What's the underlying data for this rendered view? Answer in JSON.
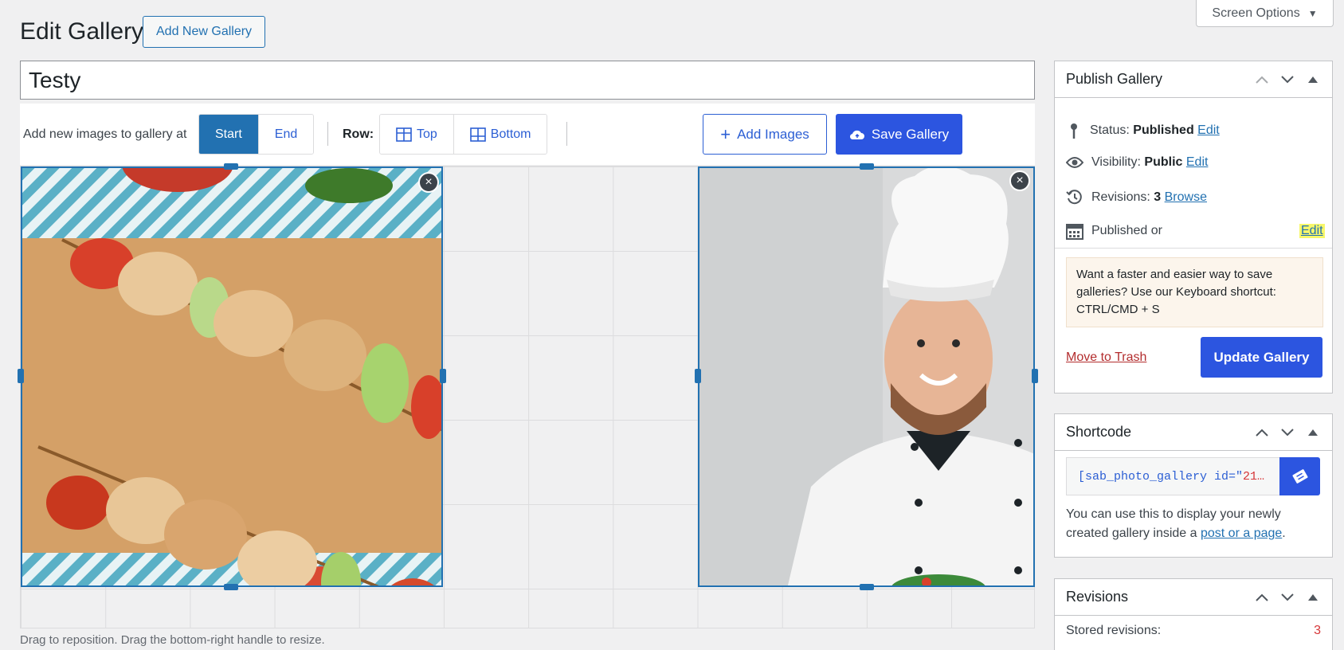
{
  "header": {
    "title": "Edit Gallery",
    "add_new_label": "Add New Gallery",
    "screen_options_label": "Screen Options"
  },
  "gallery_title": "Testy",
  "toolbar": {
    "add_at_label": "Add new images to gallery at",
    "start_label": "Start",
    "end_label": "End",
    "row_label": "Row:",
    "top_label": "Top",
    "bottom_label": "Bottom",
    "add_images_label": "Add Images",
    "save_label": "Save Gallery",
    "active_position": "Start"
  },
  "grid": {
    "hint": "Drag to reposition. Drag the bottom-right handle to resize.",
    "tiles": [
      {
        "name": "skewers-image",
        "description_icon": "photo"
      },
      {
        "name": "chef-image",
        "description_icon": "photo"
      }
    ],
    "remove_symbol": "×"
  },
  "publish": {
    "title": "Publish Gallery",
    "status_label": "Status:",
    "status_value": "Published",
    "status_edit": "Edit",
    "visibility_label": "Visibility:",
    "visibility_value": "Public",
    "visibility_edit": "Edit",
    "revisions_label": "Revisions:",
    "revisions_value": "3",
    "revisions_browse": "Browse",
    "published_on_label": "Published or",
    "published_on_edit": "Edit",
    "notice_line1": "Want a faster and easier way to save galleries? Use our Keyboard shortcut:",
    "notice_shortcut": "CTRL/CMD + S",
    "trash_label": "Move to Trash",
    "update_label": "Update Gallery"
  },
  "shortcode": {
    "title": "Shortcode",
    "code_prefix": "[sab_photo_gallery id=\"",
    "code_suffix": "21…",
    "desc_prefix": "You can use this to display your newly created gallery inside a ",
    "desc_link": "post or a page",
    "desc_suffix": "."
  },
  "revisions": {
    "title": "Revisions",
    "stored_label": "Stored revisions:",
    "stored_count": "3"
  },
  "colors": {
    "accent": "#2c55e0",
    "wp_blue": "#2271b1",
    "danger": "#b32d2e",
    "highlight": "#f7f76a"
  },
  "icons": [
    "pin-icon",
    "eye-icon",
    "history-icon",
    "calendar-icon",
    "plus-icon",
    "cloud-upload-icon",
    "copy-icon",
    "chevron-up-icon",
    "chevron-down-icon",
    "triangle-up-icon",
    "close-icon",
    "table-top-icon",
    "table-bottom-icon",
    "caret-down-icon"
  ]
}
